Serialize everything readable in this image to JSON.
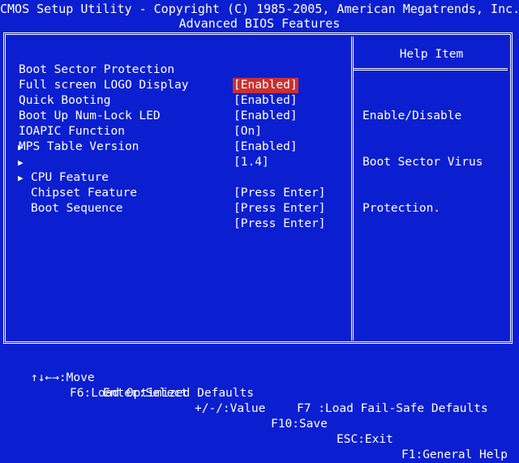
{
  "header": {
    "title": "CMOS Setup Utility - Copyright (C) 1985-2005, American Megatrends, Inc.",
    "subtitle": "Advanced BIOS Features"
  },
  "settings": [
    {
      "label": "Boot Sector Protection",
      "value": "[Enabled]",
      "submenu": false,
      "selected": true
    },
    {
      "label": "Full screen LOGO Display",
      "value": "[Enabled]",
      "submenu": false,
      "selected": false
    },
    {
      "label": "Quick Booting",
      "value": "[Enabled]",
      "submenu": false,
      "selected": false
    },
    {
      "label": "Boot Up Num-Lock LED",
      "value": "[On]",
      "submenu": false,
      "selected": false
    },
    {
      "label": "IOAPIC Function",
      "value": "[Enabled]",
      "submenu": false,
      "selected": false
    },
    {
      "label": "MPS Table Version",
      "value": "[1.4]",
      "submenu": false,
      "selected": false
    },
    {
      "label": "CPU Feature",
      "value": "[Press Enter]",
      "submenu": true,
      "selected": false
    },
    {
      "label": "Chipset Feature",
      "value": "[Press Enter]",
      "submenu": true,
      "selected": false
    },
    {
      "label": "Boot Sequence",
      "value": "[Press Enter]",
      "submenu": true,
      "selected": false
    }
  ],
  "help": {
    "title": "Help Item",
    "lines": [
      "Enable/Disable",
      "Boot Sector Virus",
      "Protection."
    ]
  },
  "footer": {
    "move": "↑↓←→:Move",
    "enter": "Enter:Select",
    "value": "+/-/:Value",
    "save": "F10:Save",
    "exit": "ESC:Exit",
    "help": "F1:General Help",
    "optimized": "F6:Load Optimized Defaults",
    "failsafe": "F7 :Load Fail-Safe Defaults"
  },
  "colors": {
    "background": "#0b1fd0",
    "text": "#ffffff",
    "selection": "#c83030"
  },
  "icons": {
    "submenu": "right-triangle-icon"
  }
}
